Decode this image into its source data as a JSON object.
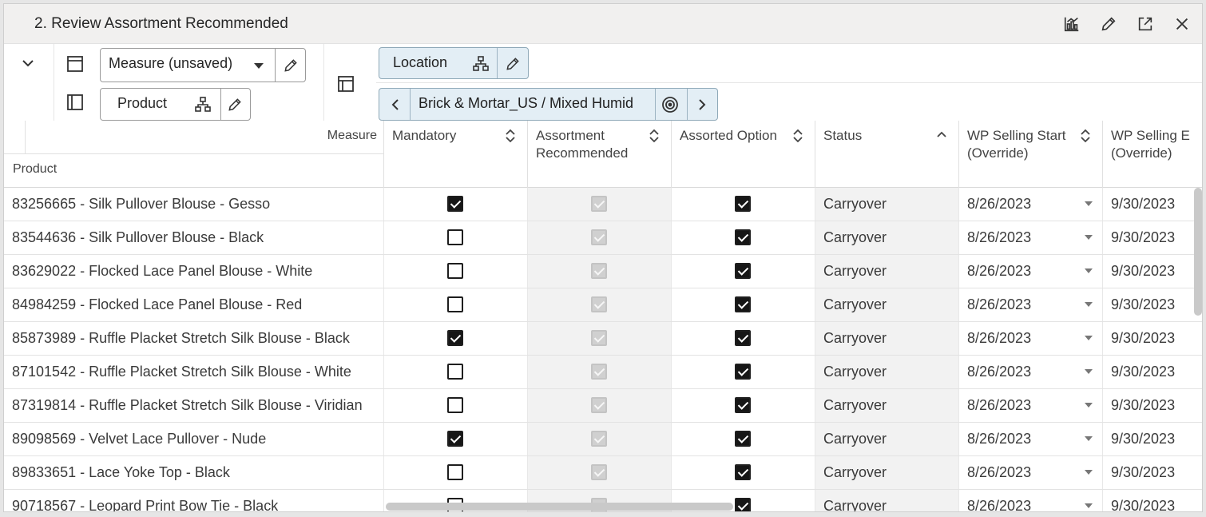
{
  "window": {
    "title": "2. Review Assortment Recommended"
  },
  "title_actions": [
    "chart-icon",
    "pencil-icon",
    "expand-icon",
    "close-icon"
  ],
  "toolbar": {
    "measure_label": "Measure (unsaved)",
    "product_label": "Product",
    "location_label": "Location",
    "location_value": "Brick & Mortar_US / Mixed Humid"
  },
  "grid": {
    "corner_measure": "Measure",
    "corner_product": "Product",
    "columns": [
      {
        "label1": "Mandatory",
        "label2": "",
        "sort": "both"
      },
      {
        "label1": "Assortment",
        "label2": "Recommended",
        "sort": "both"
      },
      {
        "label1": "Assorted Option",
        "label2": "",
        "sort": "both"
      },
      {
        "label1": "Status",
        "label2": "",
        "sort": "asc"
      },
      {
        "label1": "WP Selling Start",
        "label2": "(Override)",
        "sort": "both"
      },
      {
        "label1": "WP Selling E",
        "label2": "(Override)",
        "sort": ""
      }
    ],
    "rows": [
      {
        "product": "83256665 - Silk Pullover Blouse - Gesso",
        "mandatory": true,
        "assortment_recommended": true,
        "assorted_option": true,
        "status": "Carryover",
        "wp_start": "8/26/2023",
        "wp_end": "9/30/2023"
      },
      {
        "product": "83544636 - Silk Pullover Blouse - Black",
        "mandatory": false,
        "assortment_recommended": true,
        "assorted_option": true,
        "status": "Carryover",
        "wp_start": "8/26/2023",
        "wp_end": "9/30/2023"
      },
      {
        "product": "83629022 - Flocked Lace Panel Blouse - White",
        "mandatory": false,
        "assortment_recommended": true,
        "assorted_option": true,
        "status": "Carryover",
        "wp_start": "8/26/2023",
        "wp_end": "9/30/2023"
      },
      {
        "product": "84984259 - Flocked Lace Panel Blouse - Red",
        "mandatory": false,
        "assortment_recommended": true,
        "assorted_option": true,
        "status": "Carryover",
        "wp_start": "8/26/2023",
        "wp_end": "9/30/2023"
      },
      {
        "product": "85873989 - Ruffle Placket Stretch Silk Blouse - Black",
        "mandatory": true,
        "assortment_recommended": true,
        "assorted_option": true,
        "status": "Carryover",
        "wp_start": "8/26/2023",
        "wp_end": "9/30/2023"
      },
      {
        "product": "87101542 - Ruffle Placket Stretch Silk Blouse - White",
        "mandatory": false,
        "assortment_recommended": true,
        "assorted_option": true,
        "status": "Carryover",
        "wp_start": "8/26/2023",
        "wp_end": "9/30/2023"
      },
      {
        "product": "87319814 - Ruffle Placket Stretch Silk Blouse - Viridian",
        "mandatory": false,
        "assortment_recommended": true,
        "assorted_option": true,
        "status": "Carryover",
        "wp_start": "8/26/2023",
        "wp_end": "9/30/2023"
      },
      {
        "product": "89098569 - Velvet Lace Pullover - Nude",
        "mandatory": true,
        "assortment_recommended": true,
        "assorted_option": true,
        "status": "Carryover",
        "wp_start": "8/26/2023",
        "wp_end": "9/30/2023"
      },
      {
        "product": "89833651 - Lace Yoke Top - Black",
        "mandatory": false,
        "assortment_recommended": true,
        "assorted_option": true,
        "status": "Carryover",
        "wp_start": "8/26/2023",
        "wp_end": "9/30/2023"
      },
      {
        "product": "90718567 - Leopard Print Bow Tie - Black",
        "mandatory": false,
        "assortment_recommended": true,
        "assorted_option": true,
        "status": "Carryover",
        "wp_start": "8/26/2023",
        "wp_end": "9/30/2023"
      }
    ]
  }
}
